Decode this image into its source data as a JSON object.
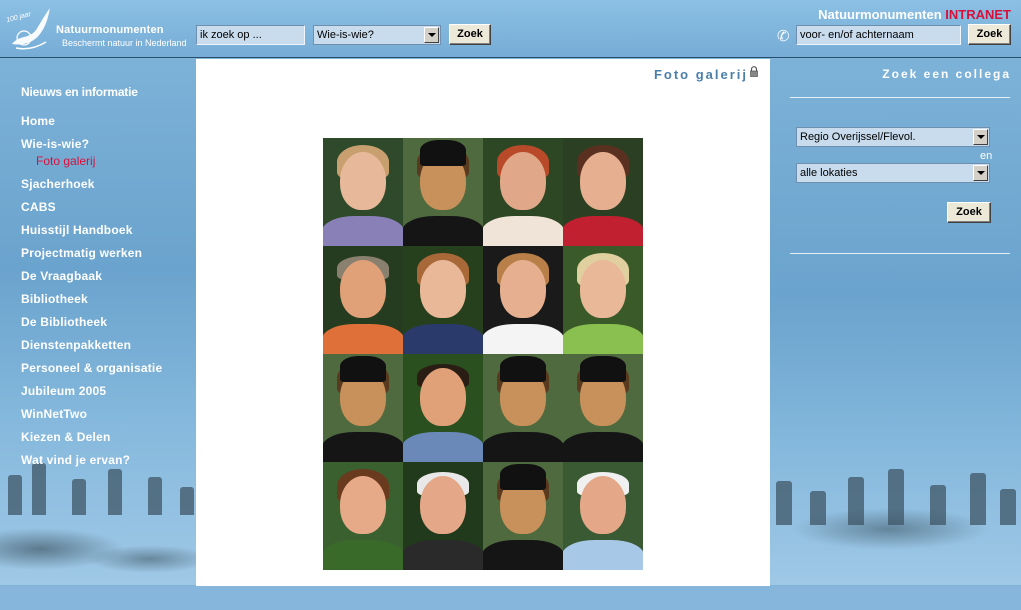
{
  "header": {
    "logo": {
      "year_badge": "100 jaar",
      "name": "Natuurmonumenten",
      "tagline": "Beschermt natuur in Nederland"
    },
    "search": {
      "query_value": "ik zoek op ...",
      "scope_selected": "Wie-is-wie?",
      "button_label": "Zoek"
    },
    "brand": {
      "name": "Natuurmonumenten",
      "suffix": "INTRANET"
    },
    "people_search": {
      "name_value": "voor- en/of achternaam",
      "button_label": "Zoek",
      "icon": "phone-icon"
    }
  },
  "sidebar": {
    "section_title": "Nieuws en informatie",
    "items": [
      {
        "label": "Home"
      },
      {
        "label": "Wie-is-wie?"
      },
      {
        "label": "Foto galerij",
        "sub": true,
        "active": true
      },
      {
        "label": "Sjacherhoek"
      },
      {
        "label": "CABS"
      },
      {
        "label": "Huisstijl Handboek"
      },
      {
        "label": "Projectmatig werken"
      },
      {
        "label": "De Vraagbaak"
      },
      {
        "label": "Bibliotheek"
      },
      {
        "label": "De Bibliotheek"
      },
      {
        "label": "Dienstenpakketten"
      },
      {
        "label": "Personeel & organisatie"
      },
      {
        "label": "Jubileum 2005"
      },
      {
        "label": "WinNetTwo"
      },
      {
        "label": "Kiezen & Delen"
      },
      {
        "label": "Wat vind je ervan?"
      }
    ]
  },
  "main": {
    "title": "Foto galerij",
    "title_icon": "lock-icon",
    "photos": [
      {
        "kind": "woman",
        "bg": "#2e4a2a",
        "skin": "#e8b89a",
        "hair": "#c8a070",
        "shirt": "#8a80b8"
      },
      {
        "kind": "portrait",
        "bg": "#4f6a3e",
        "skin": "#c8905a",
        "hair": "#5a3a1e",
        "shirt": "#151515"
      },
      {
        "kind": "woman",
        "bg": "#2d4624",
        "skin": "#e0a888",
        "hair": "#b84a2a",
        "shirt": "#f0e4d8"
      },
      {
        "kind": "woman",
        "bg": "#2b4022",
        "skin": "#e6b090",
        "hair": "#5a3020",
        "shirt": "#c02030"
      },
      {
        "kind": "man",
        "bg": "#253c20",
        "skin": "#e0a078",
        "hair": "#8a8070",
        "shirt": "#e0703a"
      },
      {
        "kind": "woman",
        "bg": "#26401e",
        "skin": "#e8b898",
        "hair": "#a86838",
        "shirt": "#2a3a6a"
      },
      {
        "kind": "woman",
        "bg": "#1a1a1a",
        "skin": "#e6b090",
        "hair": "#b88048",
        "shirt": "#f4f4f4"
      },
      {
        "kind": "woman",
        "bg": "#3a5a2a",
        "skin": "#e8b898",
        "hair": "#e0d0a0",
        "shirt": "#8ac050"
      },
      {
        "kind": "portrait",
        "bg": "#4f6a3e",
        "skin": "#c8905a",
        "hair": "#5a3a1e",
        "shirt": "#151515"
      },
      {
        "kind": "man",
        "bg": "#2a5020",
        "skin": "#e0a078",
        "hair": "#2a1e14",
        "shirt": "#6a88b8"
      },
      {
        "kind": "portrait",
        "bg": "#4f6a3e",
        "skin": "#c8905a",
        "hair": "#5a3a1e",
        "shirt": "#151515"
      },
      {
        "kind": "portrait",
        "bg": "#4f6a3e",
        "skin": "#c8905a",
        "hair": "#5a3a1e",
        "shirt": "#151515"
      },
      {
        "kind": "woman",
        "bg": "#3a6030",
        "skin": "#e6aa88",
        "hair": "#6a3a1e",
        "shirt": "#3a6a2a"
      },
      {
        "kind": "man",
        "bg": "#223a1c",
        "skin": "#e4a888",
        "hair": "#e8e8e8",
        "shirt": "#2a2a2a"
      },
      {
        "kind": "portrait",
        "bg": "#4f6a3e",
        "skin": "#c8905a",
        "hair": "#5a3a1e",
        "shirt": "#151515"
      },
      {
        "kind": "man",
        "bg": "#3a5a34",
        "skin": "#e4a888",
        "hair": "#f0f0f0",
        "shirt": "#a8c8e8"
      }
    ]
  },
  "right": {
    "title": "Zoek een collega",
    "region_selected": "Regio Overijssel/Flevol.",
    "conjunction": "en",
    "location_selected": "alle lokaties",
    "button_label": "Zoek"
  }
}
